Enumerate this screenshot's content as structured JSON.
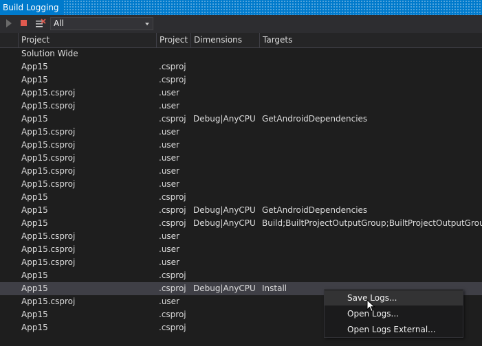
{
  "window": {
    "title": "Build Logging"
  },
  "toolbar": {
    "filter": {
      "selected": "All"
    }
  },
  "table": {
    "columns": [
      "Project",
      "Project",
      "Dimensions",
      "Targets"
    ],
    "rows": [
      [
        "Solution Wide",
        "",
        "",
        ""
      ],
      [
        "App15",
        ".csproj",
        "",
        ""
      ],
      [
        "App15",
        ".csproj",
        "",
        ""
      ],
      [
        "App15.csproj",
        ".user",
        "",
        ""
      ],
      [
        "App15.csproj",
        ".user",
        "",
        ""
      ],
      [
        "App15",
        ".csproj",
        "Debug|AnyCPU",
        "GetAndroidDependencies"
      ],
      [
        "App15.csproj",
        ".user",
        "",
        ""
      ],
      [
        "App15.csproj",
        ".user",
        "",
        ""
      ],
      [
        "App15.csproj",
        ".user",
        "",
        ""
      ],
      [
        "App15.csproj",
        ".user",
        "",
        ""
      ],
      [
        "App15.csproj",
        ".user",
        "",
        ""
      ],
      [
        "App15",
        ".csproj",
        "",
        ""
      ],
      [
        "App15",
        ".csproj",
        "Debug|AnyCPU",
        "GetAndroidDependencies"
      ],
      [
        "App15",
        ".csproj",
        "Debug|AnyCPU",
        "Build;BuiltProjectOutputGroup;BuiltProjectOutputGroupDepe"
      ],
      [
        "App15.csproj",
        ".user",
        "",
        ""
      ],
      [
        "App15.csproj",
        ".user",
        "",
        ""
      ],
      [
        "App15.csproj",
        ".user",
        "",
        ""
      ],
      [
        "App15",
        ".csproj",
        "",
        ""
      ],
      [
        "App15",
        ".csproj",
        "Debug|AnyCPU",
        "Install"
      ],
      [
        "App15.csproj",
        ".user",
        "",
        ""
      ],
      [
        "App15",
        ".csproj",
        "",
        ""
      ],
      [
        "App15",
        ".csproj",
        "",
        ""
      ]
    ],
    "selected_row": 18
  },
  "context_menu": {
    "items": [
      "Save Logs...",
      "Open Logs...",
      "Open Logs External..."
    ],
    "highlighted": 0
  },
  "colors": {
    "accent": "#007acc",
    "stop": "#e05a4f",
    "background": "#1e1e1e"
  },
  "icons": [
    "play-icon",
    "stop-icon",
    "clear-icon",
    "chevron-down-icon",
    "mouse-cursor-icon"
  ]
}
